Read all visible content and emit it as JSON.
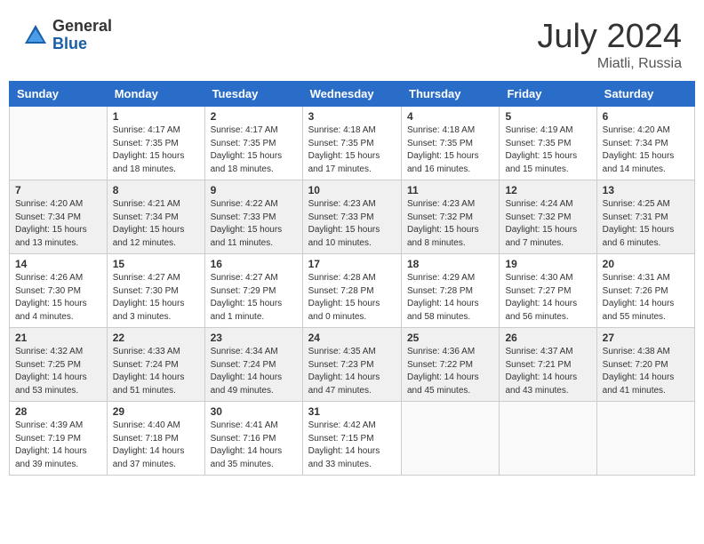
{
  "header": {
    "logo_general": "General",
    "logo_blue": "Blue",
    "month_year": "July 2024",
    "location": "Miatli, Russia"
  },
  "days_of_week": [
    "Sunday",
    "Monday",
    "Tuesday",
    "Wednesday",
    "Thursday",
    "Friday",
    "Saturday"
  ],
  "weeks": [
    [
      {
        "day": "",
        "info": ""
      },
      {
        "day": "1",
        "info": "Sunrise: 4:17 AM\nSunset: 7:35 PM\nDaylight: 15 hours\nand 18 minutes."
      },
      {
        "day": "2",
        "info": "Sunrise: 4:17 AM\nSunset: 7:35 PM\nDaylight: 15 hours\nand 18 minutes."
      },
      {
        "day": "3",
        "info": "Sunrise: 4:18 AM\nSunset: 7:35 PM\nDaylight: 15 hours\nand 17 minutes."
      },
      {
        "day": "4",
        "info": "Sunrise: 4:18 AM\nSunset: 7:35 PM\nDaylight: 15 hours\nand 16 minutes."
      },
      {
        "day": "5",
        "info": "Sunrise: 4:19 AM\nSunset: 7:35 PM\nDaylight: 15 hours\nand 15 minutes."
      },
      {
        "day": "6",
        "info": "Sunrise: 4:20 AM\nSunset: 7:34 PM\nDaylight: 15 hours\nand 14 minutes."
      }
    ],
    [
      {
        "day": "7",
        "info": "Sunrise: 4:20 AM\nSunset: 7:34 PM\nDaylight: 15 hours\nand 13 minutes."
      },
      {
        "day": "8",
        "info": "Sunrise: 4:21 AM\nSunset: 7:34 PM\nDaylight: 15 hours\nand 12 minutes."
      },
      {
        "day": "9",
        "info": "Sunrise: 4:22 AM\nSunset: 7:33 PM\nDaylight: 15 hours\nand 11 minutes."
      },
      {
        "day": "10",
        "info": "Sunrise: 4:23 AM\nSunset: 7:33 PM\nDaylight: 15 hours\nand 10 minutes."
      },
      {
        "day": "11",
        "info": "Sunrise: 4:23 AM\nSunset: 7:32 PM\nDaylight: 15 hours\nand 8 minutes."
      },
      {
        "day": "12",
        "info": "Sunrise: 4:24 AM\nSunset: 7:32 PM\nDaylight: 15 hours\nand 7 minutes."
      },
      {
        "day": "13",
        "info": "Sunrise: 4:25 AM\nSunset: 7:31 PM\nDaylight: 15 hours\nand 6 minutes."
      }
    ],
    [
      {
        "day": "14",
        "info": "Sunrise: 4:26 AM\nSunset: 7:30 PM\nDaylight: 15 hours\nand 4 minutes."
      },
      {
        "day": "15",
        "info": "Sunrise: 4:27 AM\nSunset: 7:30 PM\nDaylight: 15 hours\nand 3 minutes."
      },
      {
        "day": "16",
        "info": "Sunrise: 4:27 AM\nSunset: 7:29 PM\nDaylight: 15 hours\nand 1 minute."
      },
      {
        "day": "17",
        "info": "Sunrise: 4:28 AM\nSunset: 7:28 PM\nDaylight: 15 hours\nand 0 minutes."
      },
      {
        "day": "18",
        "info": "Sunrise: 4:29 AM\nSunset: 7:28 PM\nDaylight: 14 hours\nand 58 minutes."
      },
      {
        "day": "19",
        "info": "Sunrise: 4:30 AM\nSunset: 7:27 PM\nDaylight: 14 hours\nand 56 minutes."
      },
      {
        "day": "20",
        "info": "Sunrise: 4:31 AM\nSunset: 7:26 PM\nDaylight: 14 hours\nand 55 minutes."
      }
    ],
    [
      {
        "day": "21",
        "info": "Sunrise: 4:32 AM\nSunset: 7:25 PM\nDaylight: 14 hours\nand 53 minutes."
      },
      {
        "day": "22",
        "info": "Sunrise: 4:33 AM\nSunset: 7:24 PM\nDaylight: 14 hours\nand 51 minutes."
      },
      {
        "day": "23",
        "info": "Sunrise: 4:34 AM\nSunset: 7:24 PM\nDaylight: 14 hours\nand 49 minutes."
      },
      {
        "day": "24",
        "info": "Sunrise: 4:35 AM\nSunset: 7:23 PM\nDaylight: 14 hours\nand 47 minutes."
      },
      {
        "day": "25",
        "info": "Sunrise: 4:36 AM\nSunset: 7:22 PM\nDaylight: 14 hours\nand 45 minutes."
      },
      {
        "day": "26",
        "info": "Sunrise: 4:37 AM\nSunset: 7:21 PM\nDaylight: 14 hours\nand 43 minutes."
      },
      {
        "day": "27",
        "info": "Sunrise: 4:38 AM\nSunset: 7:20 PM\nDaylight: 14 hours\nand 41 minutes."
      }
    ],
    [
      {
        "day": "28",
        "info": "Sunrise: 4:39 AM\nSunset: 7:19 PM\nDaylight: 14 hours\nand 39 minutes."
      },
      {
        "day": "29",
        "info": "Sunrise: 4:40 AM\nSunset: 7:18 PM\nDaylight: 14 hours\nand 37 minutes."
      },
      {
        "day": "30",
        "info": "Sunrise: 4:41 AM\nSunset: 7:16 PM\nDaylight: 14 hours\nand 35 minutes."
      },
      {
        "day": "31",
        "info": "Sunrise: 4:42 AM\nSunset: 7:15 PM\nDaylight: 14 hours\nand 33 minutes."
      },
      {
        "day": "",
        "info": ""
      },
      {
        "day": "",
        "info": ""
      },
      {
        "day": "",
        "info": ""
      }
    ]
  ]
}
